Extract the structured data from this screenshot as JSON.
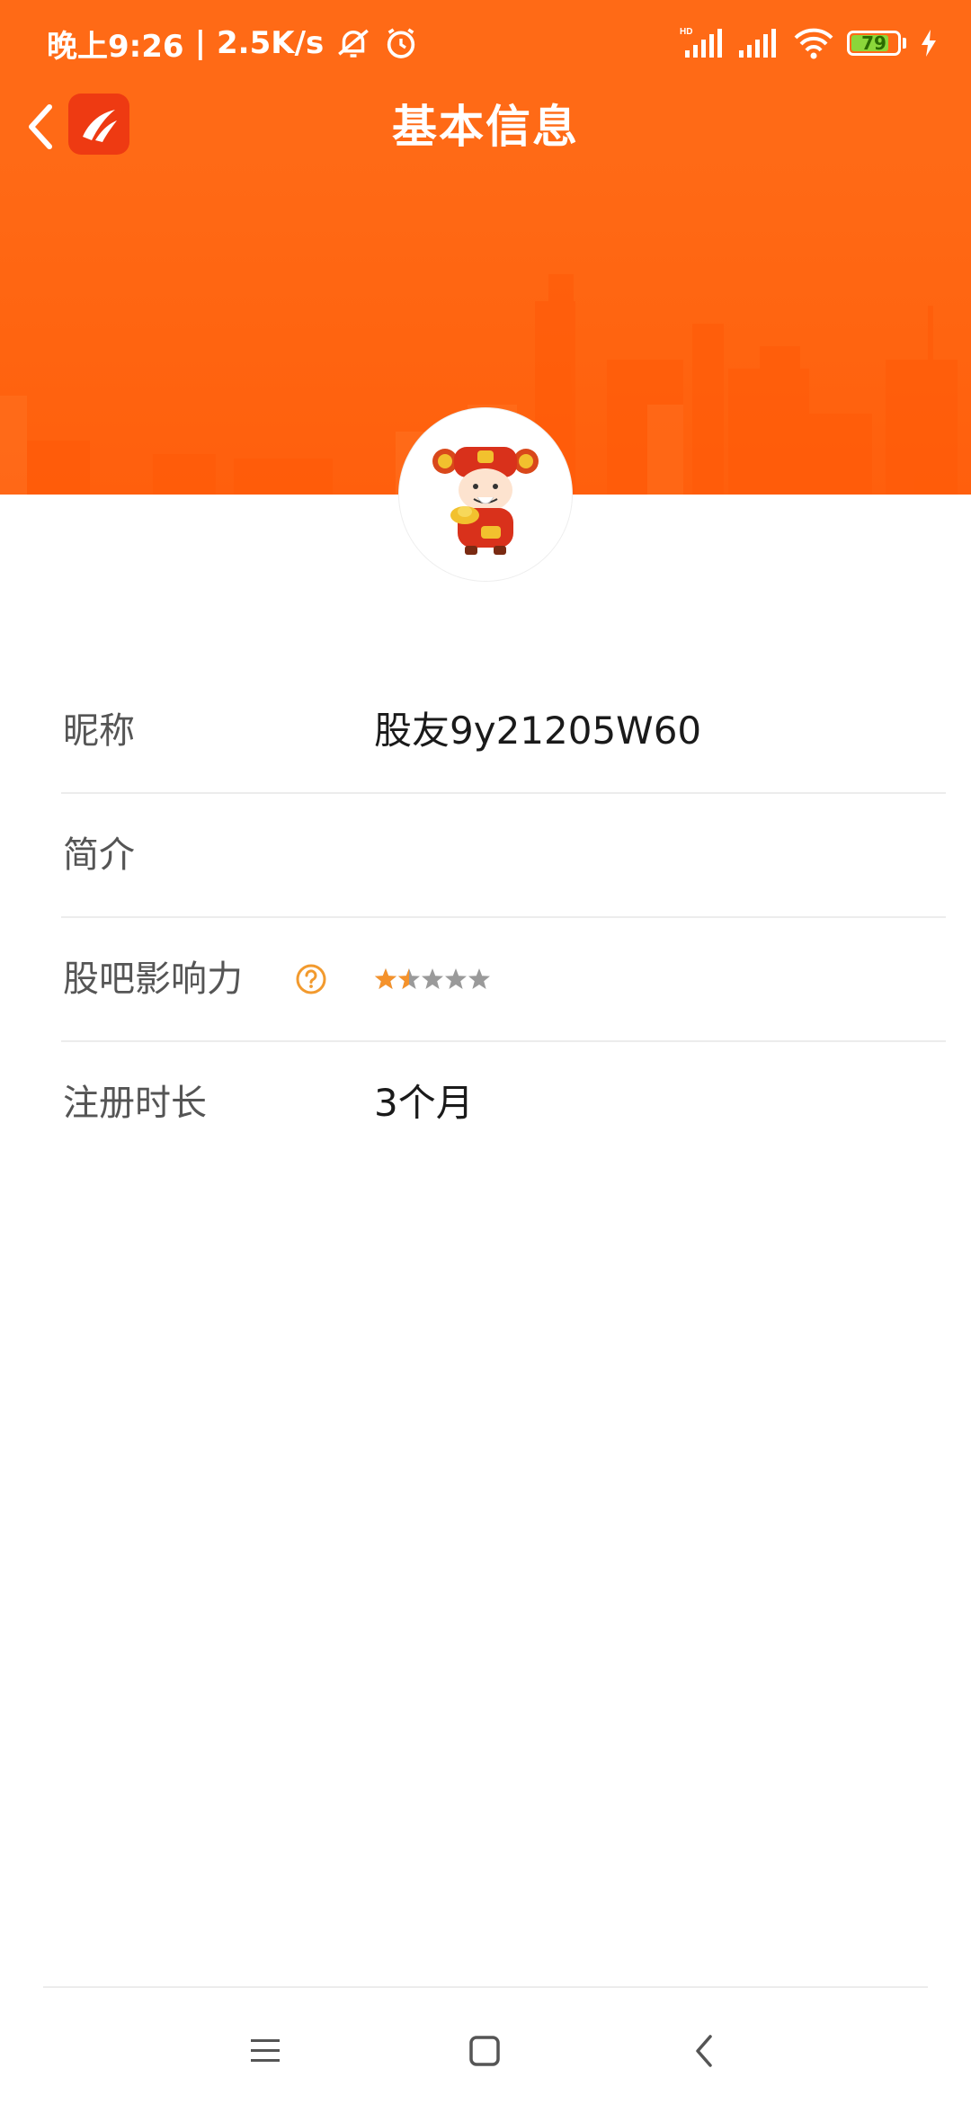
{
  "status_bar": {
    "time": "晚上9:26",
    "separator": "|",
    "network_speed": "2.5K/s",
    "signal_label": "HD",
    "battery_level": "79",
    "icons": [
      "mute-bell-icon",
      "alarm-icon",
      "signal-icon",
      "wifi-icon",
      "battery-icon",
      "charging-icon"
    ]
  },
  "nav": {
    "title": "基本信息",
    "back_icon": "chevron-left-icon",
    "logo_icon": "app-logo-icon"
  },
  "profile": {
    "avatar_icon": "caishen-avatar-icon",
    "rows": [
      {
        "label": "昵称",
        "value": "股友9y21205W60"
      },
      {
        "label": "简介",
        "value": ""
      },
      {
        "label": "股吧影响力",
        "help_icon": "question-circle-icon",
        "rating": 1.5,
        "rating_max": 5
      },
      {
        "label": "注册时长",
        "value": "3个月"
      }
    ]
  },
  "colors": {
    "brand_orange": "#ff6a16",
    "star_active": "#f5922b",
    "star_inactive": "#9a9a9a",
    "help_icon": "#f29a2e"
  },
  "system_nav": {
    "icons": [
      "menu-icon",
      "home-square-icon",
      "back-triangle-icon"
    ]
  }
}
